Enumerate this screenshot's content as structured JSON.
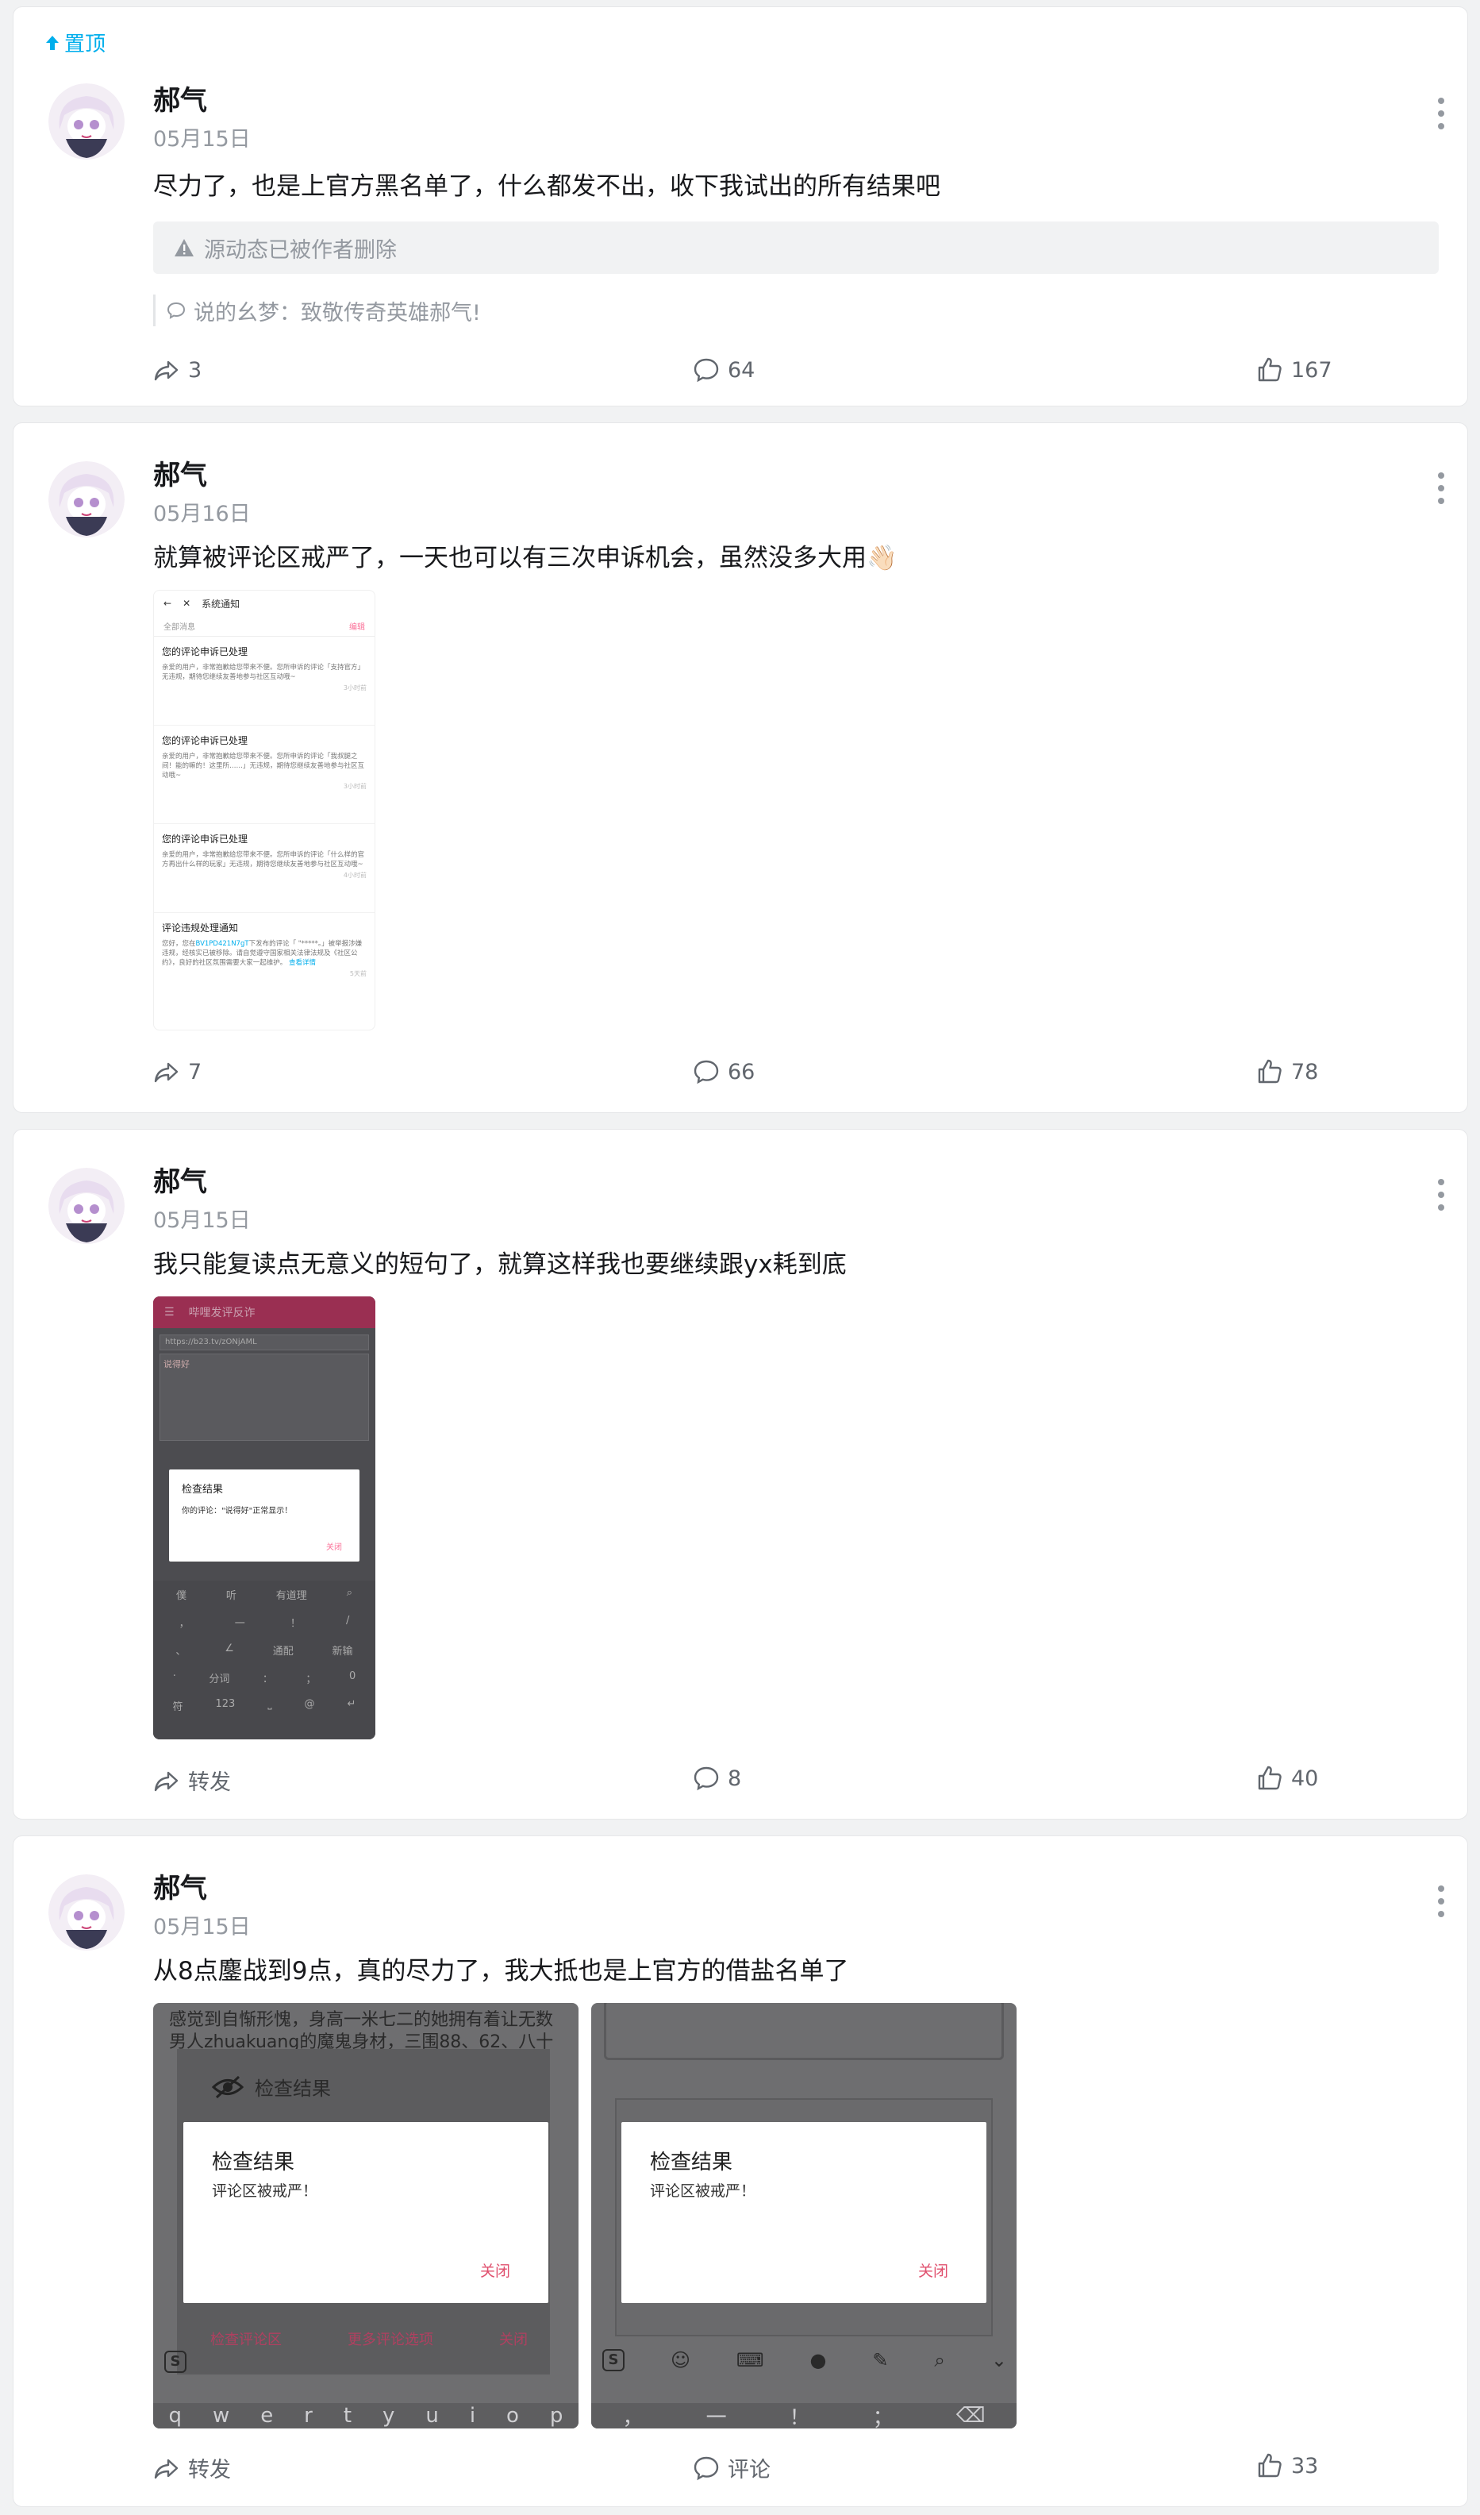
{
  "pin_label": "置顶",
  "posts": [
    {
      "username": "郝气",
      "date": "05月15日",
      "text": "尽力了，也是上官方黑名单了，什么都发不出，收下我试出的所有结果吧",
      "deleted_notice": "源动态已被作者删除",
      "quote": "说的幺梦：致敬传奇英雄郝气!",
      "forward": "3",
      "comment": "64",
      "like": "167"
    },
    {
      "username": "郝气",
      "date": "05月16日",
      "text": "就算被评论区戒严了，一天也可以有三次申诉机会，虽然没多大用👋🏻",
      "forward": "7",
      "comment": "66",
      "like": "78",
      "screenshot": {
        "title": "系统通知",
        "all": "全部消息",
        "edit": "编辑",
        "items": [
          {
            "title": "您的评论申诉已处理",
            "body": "亲爱的用户，非常抱歉给您带来不便。您所申诉的评论「支持官方」无违规，期待您继续友善地参与社区互动哦~",
            "time": "3小时前"
          },
          {
            "title": "您的评论申诉已处理",
            "body": "亲爱的用户，非常抱歉给您带来不便。您所申诉的评论「我叔腿之间！能的嘛的！这里所……」无违规，期待您继续友善地参与社区互动哦~",
            "time": "3小时前"
          },
          {
            "title": "您的评论申诉已处理",
            "body": "亲爱的用户，非常抱歉给您带来不便。您所申诉的评论「什么样的官方再出什么样的玩家」无违规，期待您继续友善地参与社区互动哦~",
            "time": "4小时前"
          },
          {
            "title": "评论违规处理通知",
            "body_pre": "您好，您在",
            "link": "BV1PD421N7gT",
            "body_post": "下发布的评论「 \"*****。」被举报涉嫌违规，经核实已被移除。请自觉遵守国家相关法律法规及《社区公约》，良好的社区氛围需要大家一起维护。",
            "more": "查看详情",
            "time": "5天前"
          }
        ]
      }
    },
    {
      "username": "郝气",
      "date": "05月15日",
      "text": "我只能复读点无意义的短句了，就算这样我也要继续跟yx耗到底",
      "forward": "转发",
      "comment": "8",
      "like": "40",
      "screenshot": {
        "app_title": "哔哩发评反诈",
        "url": "https://b23.tv/zONjAML",
        "input": "说得好",
        "dialog_title": "检查结果",
        "dialog_msg": "你的评论：\"说得好\"正常显示！",
        "dialog_close": "关闭",
        "kb_row1": [
          "僕",
          "听",
          "有道理"
        ],
        "kb_row2": [
          "，",
          "一",
          "！",
          "/"
        ],
        "kb_row3": [
          "、",
          "∠",
          "通配",
          "新输"
        ],
        "kb_row4": [
          "·",
          "分词",
          "：",
          "；",
          "0"
        ],
        "kb_row5": [
          "符",
          "123",
          "⎵",
          "@",
          "↵"
        ]
      }
    },
    {
      "username": "郝气",
      "date": "05月15日",
      "text": "从8点鏖战到9点，真的尽力了，我大抵也是上官方的借盐名单了",
      "forward": "转发",
      "comment": "评论",
      "like": "33",
      "screenshots": [
        {
          "bg_text": "感觉到自惭形愧，身高一米七二的她拥有着让无数男人zhuakuang的魔鬼身材，三围88、62、八十",
          "bg_title": "检查结果",
          "dialog_title": "检查结果",
          "dialog_msg": "评论区被戒严！",
          "dialog_close": "关闭",
          "bottom_links": [
            "检查评论区",
            "更多评论选项",
            "关闭"
          ],
          "keys": [
            "q",
            "w",
            "e",
            "r",
            "t",
            "y",
            "u",
            "i",
            "o",
            "p"
          ]
        },
        {
          "dialog_title": "检查结果",
          "dialog_msg": "评论区被戒严！",
          "dialog_close": "关闭",
          "keys": [
            "，",
            "一",
            "！",
            "；",
            "⌫"
          ]
        }
      ]
    }
  ],
  "colors": {
    "accent": "#00aeec",
    "pink": "#fb7299",
    "muted": "#9499a0"
  }
}
